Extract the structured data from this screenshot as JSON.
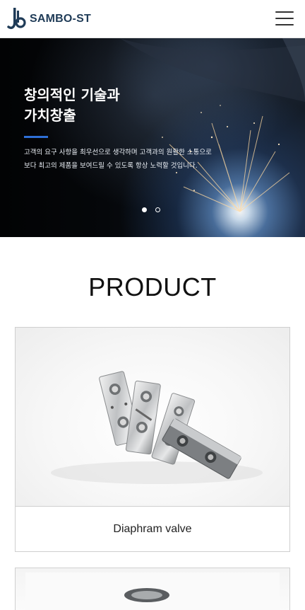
{
  "header": {
    "logo_text": "SAMBO-ST",
    "menu_icon": "hamburger-menu-icon"
  },
  "hero": {
    "title_lines": [
      "창의적인 기술과",
      "가치창출"
    ],
    "description_lines": [
      "고객의 요구 사항을 최우선으로 생각하며 고객과의 원활한 소통으로",
      "보다 최고의 제품을 보여드릴 수 있도록 항상 노력할 것입니다."
    ],
    "slides_total": 2,
    "active_slide": 1,
    "accent_color": "#2e6fd6"
  },
  "section": {
    "title": "PRODUCT"
  },
  "products": [
    {
      "name": "Diaphram valve"
    },
    {
      "name": ""
    }
  ]
}
